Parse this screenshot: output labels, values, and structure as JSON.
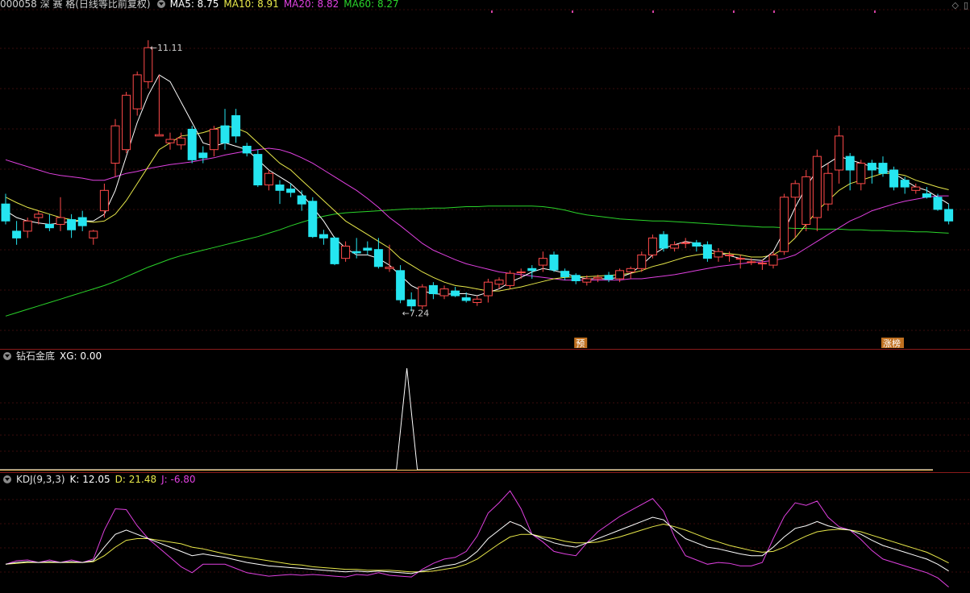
{
  "header": {
    "stock_label": "000058 深 赛 格(日线等比前复权)",
    "ma5": "MA5: 8.75",
    "ma10": "MA10: 8.91",
    "ma20": "MA20: 8.82",
    "ma60": "MA60: 8.27"
  },
  "panel2": {
    "title": "钻石金底",
    "value": "XG: 0.00"
  },
  "panel3": {
    "title": "KDJ(9,3,3)",
    "k": "K: 12.05",
    "d": "D: 21.48",
    "j": "J: -6.80"
  },
  "colors": {
    "up": "#ff4a4a",
    "down": "#25e5f0",
    "ma5": "#ffffff",
    "ma10": "#e8e84a",
    "ma20": "#e040e0",
    "ma60": "#2ad42a",
    "grid": "#3a0b0b",
    "separator": "#8b1a1a",
    "label_bg": "#c07020"
  },
  "chart_data": [
    {
      "type": "candlestick",
      "title": "000058 深 赛 格(日线等比前复权)",
      "ylim": [
        6.9,
        11.5
      ],
      "annotations": {
        "high": "11.11",
        "low": "7.24",
        "tags": [
          {
            "index": 52,
            "text": "预"
          },
          {
            "index": 80,
            "text": "涨榜"
          }
        ]
      },
      "series_names": [
        "MA5",
        "MA10",
        "MA20",
        "MA60"
      ],
      "candles": [
        [
          8.7,
          8.45,
          8.85,
          8.4
        ],
        [
          8.3,
          8.2,
          8.45,
          8.1
        ],
        [
          8.3,
          8.45,
          8.5,
          8.2
        ],
        [
          8.5,
          8.55,
          8.6,
          8.4
        ],
        [
          8.4,
          8.35,
          8.55,
          8.3
        ],
        [
          8.4,
          8.5,
          8.8,
          8.3
        ],
        [
          8.47,
          8.32,
          8.55,
          8.2
        ],
        [
          8.5,
          8.38,
          8.6,
          8.3
        ],
        [
          8.2,
          8.3,
          8.32,
          8.1
        ],
        [
          8.6,
          8.9,
          9.0,
          8.5
        ],
        [
          9.3,
          9.85,
          9.95,
          9.1
        ],
        [
          9.5,
          10.3,
          10.35,
          9.45
        ],
        [
          10.1,
          10.6,
          10.65,
          10.0
        ],
        [
          10.5,
          11.0,
          11.11,
          10.4
        ],
        [
          9.7,
          9.72,
          10.6,
          9.7
        ],
        [
          9.6,
          9.65,
          9.75,
          9.5
        ],
        [
          9.57,
          9.67,
          9.75,
          9.5
        ],
        [
          9.8,
          9.35,
          9.85,
          9.3
        ],
        [
          9.45,
          9.38,
          9.55,
          9.3
        ],
        [
          9.5,
          9.8,
          9.85,
          9.4
        ],
        [
          9.85,
          9.6,
          10.1,
          9.5
        ],
        [
          10.0,
          9.7,
          10.1,
          9.6
        ],
        [
          9.55,
          9.45,
          9.6,
          9.4
        ],
        [
          9.43,
          8.98,
          9.5,
          8.95
        ],
        [
          8.98,
          9.15,
          9.2,
          8.9
        ],
        [
          8.98,
          8.9,
          9.05,
          8.7
        ],
        [
          8.92,
          8.87,
          9.0,
          8.8
        ],
        [
          8.82,
          8.7,
          8.9,
          8.6
        ],
        [
          8.74,
          8.22,
          8.8,
          8.2
        ],
        [
          8.25,
          8.2,
          8.32,
          8.1
        ],
        [
          8.2,
          7.82,
          8.22,
          7.8
        ],
        [
          7.9,
          8.08,
          8.15,
          7.85
        ],
        [
          8.0,
          7.98,
          8.2,
          7.9
        ],
        [
          8.05,
          8.02,
          8.15,
          7.95
        ],
        [
          8.03,
          7.78,
          8.2,
          7.75
        ],
        [
          7.75,
          7.77,
          8.1,
          7.7
        ],
        [
          7.72,
          7.29,
          7.8,
          7.24
        ],
        [
          7.29,
          7.2,
          7.4,
          7.12
        ],
        [
          7.2,
          7.48,
          7.52,
          7.15
        ],
        [
          7.5,
          7.38,
          7.55,
          7.3
        ],
        [
          7.35,
          7.45,
          7.5,
          7.3
        ],
        [
          7.42,
          7.35,
          7.48,
          7.33
        ],
        [
          7.32,
          7.28,
          7.4,
          7.25
        ],
        [
          7.25,
          7.3,
          7.35,
          7.2
        ],
        [
          7.35,
          7.55,
          7.6,
          7.25
        ],
        [
          7.52,
          7.58,
          7.62,
          7.45
        ],
        [
          7.5,
          7.68,
          7.72,
          7.45
        ],
        [
          7.7,
          7.7,
          7.75,
          7.6
        ],
        [
          7.75,
          7.72,
          7.8,
          7.6
        ],
        [
          7.8,
          7.9,
          8.0,
          7.7
        ],
        [
          7.95,
          7.73,
          8.0,
          7.7
        ],
        [
          7.71,
          7.63,
          7.75,
          7.58
        ],
        [
          7.65,
          7.57,
          7.68,
          7.52
        ],
        [
          7.55,
          7.6,
          7.65,
          7.5
        ],
        [
          7.6,
          7.62,
          7.66,
          7.55
        ],
        [
          7.65,
          7.59,
          7.7,
          7.55
        ],
        [
          7.6,
          7.72,
          7.75,
          7.55
        ],
        [
          7.7,
          7.75,
          7.78,
          7.6
        ],
        [
          7.75,
          7.95,
          8.0,
          7.7
        ],
        [
          7.95,
          8.2,
          8.25,
          7.9
        ],
        [
          8.25,
          8.05,
          8.3,
          8.0
        ],
        [
          8.05,
          8.1,
          8.15,
          8.0
        ],
        [
          8.12,
          8.13,
          8.2,
          8.05
        ],
        [
          8.13,
          8.08,
          8.17,
          8.0
        ],
        [
          8.1,
          7.9,
          8.15,
          7.85
        ],
        [
          7.92,
          8.0,
          8.05,
          7.85
        ],
        [
          7.95,
          7.95,
          8.0,
          7.85
        ],
        [
          7.9,
          7.9,
          7.95,
          7.75
        ],
        [
          7.85,
          7.85,
          7.9,
          7.8
        ],
        [
          7.83,
          7.83,
          7.88,
          7.73
        ],
        [
          7.8,
          7.95,
          8.0,
          7.75
        ],
        [
          8.0,
          8.8,
          8.85,
          7.95
        ],
        [
          8.8,
          9.0,
          9.05,
          8.2
        ],
        [
          8.4,
          9.1,
          9.2,
          8.3
        ],
        [
          8.5,
          9.4,
          9.5,
          8.3
        ],
        [
          8.7,
          9.15,
          9.3,
          8.6
        ],
        [
          9.2,
          9.7,
          9.85,
          9.0
        ],
        [
          9.4,
          9.2,
          9.45,
          8.9
        ],
        [
          9.0,
          9.3,
          9.35,
          8.9
        ],
        [
          9.3,
          9.2,
          9.35,
          9.0
        ],
        [
          9.3,
          9.15,
          9.4,
          9.1
        ],
        [
          9.2,
          8.95,
          9.25,
          8.9
        ],
        [
          9.05,
          8.95,
          9.1,
          8.85
        ],
        [
          8.9,
          8.95,
          9.0,
          8.85
        ],
        [
          8.85,
          8.8,
          8.95,
          8.78
        ],
        [
          8.8,
          8.62,
          8.85,
          8.6
        ],
        [
          8.62,
          8.45,
          8.7,
          8.4
        ]
      ],
      "ma5": [
        8.6,
        8.5,
        8.45,
        8.42,
        8.4,
        8.42,
        8.44,
        8.45,
        8.45,
        8.55,
        8.9,
        9.4,
        9.9,
        10.3,
        10.6,
        10.5,
        10.2,
        9.9,
        9.6,
        9.55,
        9.6,
        9.55,
        9.5,
        9.35,
        9.2,
        9.1,
        9.0,
        8.85,
        8.65,
        8.45,
        8.2,
        8.05,
        7.95,
        7.95,
        7.9,
        7.8,
        7.65,
        7.5,
        7.42,
        7.38,
        7.37,
        7.38,
        7.38,
        7.35,
        7.4,
        7.45,
        7.55,
        7.62,
        7.7,
        7.75,
        7.72,
        7.68,
        7.63,
        7.6,
        7.6,
        7.6,
        7.62,
        7.68,
        7.8,
        7.95,
        8.05,
        8.1,
        8.15,
        8.12,
        8.05,
        7.98,
        7.94,
        7.9,
        7.88,
        7.87,
        8.0,
        8.3,
        8.65,
        8.95,
        9.2,
        9.3,
        9.4,
        9.35,
        9.3,
        9.25,
        9.2,
        9.15,
        9.05,
        8.95,
        8.9,
        8.8,
        8.7
      ],
      "ma10": [
        8.8,
        8.72,
        8.65,
        8.6,
        8.55,
        8.5,
        8.47,
        8.45,
        8.43,
        8.45,
        8.55,
        8.75,
        9.0,
        9.25,
        9.5,
        9.6,
        9.7,
        9.72,
        9.75,
        9.8,
        9.85,
        9.82,
        9.75,
        9.6,
        9.45,
        9.3,
        9.2,
        9.05,
        8.9,
        8.75,
        8.6,
        8.45,
        8.35,
        8.25,
        8.15,
        8.05,
        7.9,
        7.8,
        7.7,
        7.62,
        7.55,
        7.5,
        7.48,
        7.45,
        7.42,
        7.42,
        7.45,
        7.48,
        7.52,
        7.56,
        7.6,
        7.62,
        7.63,
        7.63,
        7.64,
        7.65,
        7.66,
        7.68,
        7.72,
        7.78,
        7.82,
        7.87,
        7.92,
        7.95,
        7.97,
        7.98,
        7.97,
        7.95,
        7.92,
        7.92,
        7.95,
        8.05,
        8.2,
        8.4,
        8.6,
        8.75,
        8.9,
        9.0,
        9.05,
        9.1,
        9.15,
        9.15,
        9.12,
        9.05,
        9.0,
        8.95,
        8.91
      ],
      "ma20": [
        9.35,
        9.3,
        9.25,
        9.2,
        9.15,
        9.12,
        9.1,
        9.08,
        9.05,
        9.05,
        9.1,
        9.15,
        9.18,
        9.22,
        9.25,
        9.28,
        9.3,
        9.32,
        9.35,
        9.38,
        9.42,
        9.45,
        9.48,
        9.5,
        9.52,
        9.5,
        9.45,
        9.38,
        9.3,
        9.2,
        9.1,
        9.0,
        8.9,
        8.78,
        8.65,
        8.5,
        8.38,
        8.25,
        8.12,
        8.02,
        7.95,
        7.88,
        7.82,
        7.78,
        7.74,
        7.7,
        7.68,
        7.66,
        7.64,
        7.62,
        7.6,
        7.58,
        7.58,
        7.58,
        7.58,
        7.58,
        7.58,
        7.6,
        7.6,
        7.62,
        7.64,
        7.66,
        7.69,
        7.72,
        7.75,
        7.78,
        7.8,
        7.82,
        7.84,
        7.85,
        7.87,
        7.9,
        7.95,
        8.05,
        8.15,
        8.25,
        8.35,
        8.45,
        8.52,
        8.6,
        8.65,
        8.7,
        8.74,
        8.77,
        8.8,
        8.82,
        8.82
      ],
      "ma60": [
        7.05,
        7.1,
        7.15,
        7.2,
        7.25,
        7.3,
        7.35,
        7.4,
        7.45,
        7.5,
        7.56,
        7.63,
        7.7,
        7.77,
        7.83,
        7.89,
        7.94,
        7.98,
        8.02,
        8.06,
        8.1,
        8.14,
        8.18,
        8.22,
        8.27,
        8.32,
        8.38,
        8.43,
        8.48,
        8.52,
        8.55,
        8.57,
        8.58,
        8.59,
        8.6,
        8.61,
        8.62,
        8.63,
        8.63,
        8.64,
        8.64,
        8.65,
        8.66,
        8.66,
        8.67,
        8.67,
        8.67,
        8.67,
        8.67,
        8.66,
        8.64,
        8.61,
        8.57,
        8.54,
        8.52,
        8.5,
        8.48,
        8.47,
        8.46,
        8.45,
        8.45,
        8.44,
        8.43,
        8.42,
        8.41,
        8.4,
        8.39,
        8.38,
        8.37,
        8.36,
        8.36,
        8.35,
        8.34,
        8.34,
        8.33,
        8.33,
        8.33,
        8.32,
        8.32,
        8.31,
        8.31,
        8.3,
        8.3,
        8.29,
        8.29,
        8.28,
        8.27
      ]
    },
    {
      "type": "line",
      "title": "钻石金底",
      "series_names": [
        "XG"
      ],
      "ylim": [
        0,
        1
      ],
      "spike_index": 36,
      "xg_value": "XG: 0.00"
    },
    {
      "type": "line",
      "title": "KDJ(9,3,3)",
      "series_names": [
        "K",
        "D",
        "J"
      ],
      "ylim": [
        -10,
        110
      ],
      "K": [
        20,
        22,
        23,
        22,
        23,
        22,
        23,
        22,
        24,
        40,
        55,
        60,
        55,
        50,
        45,
        40,
        35,
        30,
        32,
        30,
        28,
        25,
        22,
        20,
        18,
        17,
        16,
        15,
        14,
        13,
        12,
        11,
        12,
        11,
        12,
        11,
        10,
        9,
        12,
        15,
        18,
        20,
        25,
        35,
        50,
        60,
        70,
        65,
        55,
        50,
        45,
        42,
        40,
        45,
        50,
        55,
        60,
        65,
        70,
        75,
        72,
        60,
        50,
        45,
        40,
        38,
        35,
        32,
        30,
        30,
        40,
        52,
        62,
        65,
        70,
        65,
        62,
        60,
        55,
        48,
        42,
        38,
        34,
        30,
        26,
        20,
        12.05
      ],
      "D": [
        20,
        21,
        22,
        22,
        22,
        22,
        22,
        22,
        23,
        30,
        40,
        48,
        50,
        50,
        48,
        46,
        44,
        40,
        38,
        35,
        32,
        30,
        28,
        26,
        24,
        22,
        20,
        19,
        17,
        16,
        15,
        14,
        14,
        13,
        13,
        13,
        12,
        11,
        11,
        12,
        14,
        16,
        20,
        26,
        35,
        44,
        52,
        55,
        55,
        52,
        50,
        47,
        45,
        45,
        46,
        49,
        52,
        56,
        60,
        64,
        67,
        64,
        60,
        55,
        50,
        46,
        42,
        39,
        36,
        34,
        35,
        40,
        47,
        53,
        58,
        60,
        61,
        60,
        58,
        54,
        50,
        46,
        42,
        38,
        34,
        28,
        21.48
      ],
      "J": [
        20,
        24,
        25,
        22,
        25,
        22,
        25,
        22,
        26,
        60,
        85,
        84,
        65,
        50,
        39,
        28,
        17,
        10,
        20,
        20,
        20,
        15,
        10,
        8,
        6,
        7,
        8,
        7,
        8,
        7,
        6,
        5,
        8,
        7,
        10,
        7,
        6,
        5,
        14,
        21,
        26,
        28,
        35,
        53,
        80,
        92,
        106,
        85,
        55,
        46,
        35,
        32,
        30,
        45,
        58,
        67,
        76,
        83,
        90,
        97,
        82,
        52,
        30,
        25,
        20,
        22,
        21,
        18,
        18,
        22,
        50,
        76,
        92,
        89,
        94,
        75,
        64,
        60,
        49,
        36,
        26,
        22,
        18,
        14,
        10,
        4,
        -6.8
      ]
    }
  ]
}
